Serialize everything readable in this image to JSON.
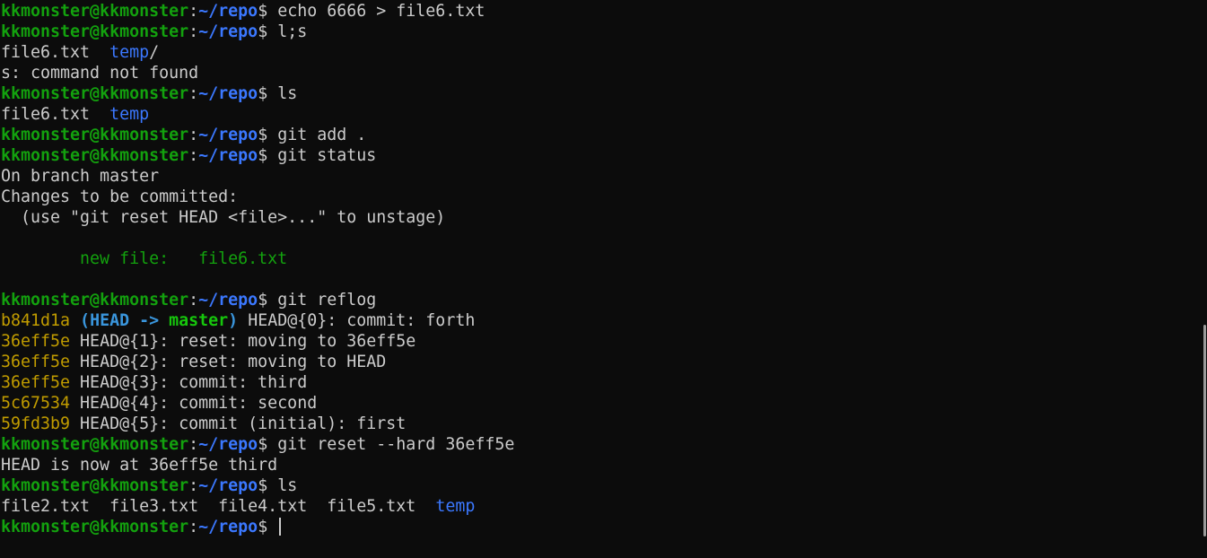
{
  "prompt": {
    "user": "kkmonster@kkmonster",
    "colon": ":",
    "path": "~/repo",
    "dollar": "$"
  },
  "colors": {
    "background": "#0c0c0c",
    "text": "#cccccc",
    "prompt_user": "#13a10e",
    "prompt_path": "#3b78ff",
    "commit_hash": "#c19c00",
    "head_ref": "#3a96dd",
    "branch_ref": "#16c60c",
    "directory": "#3b78ff"
  },
  "lines": [
    {
      "type": "prompt",
      "cmd": " echo 6666 > file6.txt"
    },
    {
      "type": "prompt",
      "cmd": " l;s"
    },
    {
      "type": "files",
      "items": [
        {
          "t": "file6.txt"
        },
        {
          "t": "  "
        },
        {
          "t": "temp",
          "cls": "c-dir"
        },
        {
          "t": "/"
        }
      ]
    },
    {
      "type": "text",
      "text": "s: command not found"
    },
    {
      "type": "prompt",
      "cmd": " ls"
    },
    {
      "type": "files",
      "items": [
        {
          "t": "file6.txt"
        },
        {
          "t": "  "
        },
        {
          "t": "temp",
          "cls": "c-dir"
        }
      ]
    },
    {
      "type": "prompt",
      "cmd": " git add ."
    },
    {
      "type": "prompt",
      "cmd": " git status"
    },
    {
      "type": "text",
      "text": "On branch master"
    },
    {
      "type": "text",
      "text": "Changes to be committed:"
    },
    {
      "type": "text",
      "text": "  (use \"git reset HEAD <file>...\" to unstage)"
    },
    {
      "type": "text",
      "text": ""
    },
    {
      "type": "text",
      "text": "        new file:   file6.txt",
      "cls": "c-newfile"
    },
    {
      "type": "text",
      "text": ""
    },
    {
      "type": "prompt",
      "cmd": " git reflog"
    },
    {
      "type": "reflog_head",
      "hash": "b841d1a",
      "open": " (",
      "head": "HEAD ->",
      "branch": "master",
      "close": ")",
      "rest": " HEAD@{0}: commit: forth"
    },
    {
      "type": "reflog",
      "hash": "36eff5e",
      "rest": " HEAD@{1}: reset: moving to 36eff5e"
    },
    {
      "type": "reflog",
      "hash": "36eff5e",
      "rest": " HEAD@{2}: reset: moving to HEAD"
    },
    {
      "type": "reflog",
      "hash": "36eff5e",
      "rest": " HEAD@{3}: commit: third"
    },
    {
      "type": "reflog",
      "hash": "5c67534",
      "rest": " HEAD@{4}: commit: second"
    },
    {
      "type": "reflog",
      "hash": "59fd3b9",
      "rest": " HEAD@{5}: commit (initial): first"
    },
    {
      "type": "prompt",
      "cmd": " git reset --hard 36eff5e"
    },
    {
      "type": "text",
      "text": "HEAD is now at 36eff5e third"
    },
    {
      "type": "prompt",
      "cmd": " ls"
    },
    {
      "type": "files",
      "items": [
        {
          "t": "file2.txt"
        },
        {
          "t": "  "
        },
        {
          "t": "file3.txt"
        },
        {
          "t": "  "
        },
        {
          "t": "file4.txt"
        },
        {
          "t": "  "
        },
        {
          "t": "file5.txt"
        },
        {
          "t": "  "
        },
        {
          "t": "temp",
          "cls": "c-dir"
        }
      ]
    },
    {
      "type": "prompt",
      "cmd": " ",
      "cursor": true
    }
  ]
}
